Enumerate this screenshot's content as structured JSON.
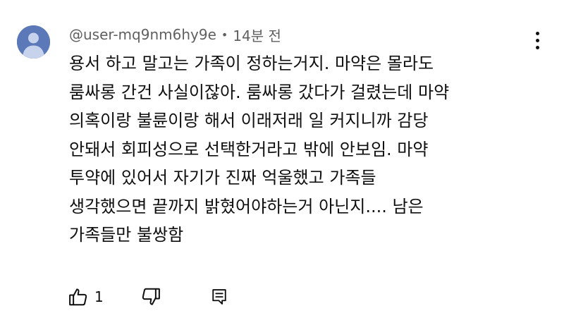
{
  "comment": {
    "author": "@user-mq9nm6hy9e",
    "separator": "•",
    "timestamp": "14분 전",
    "lines": [
      "용서 하고 말고는 가족이 정하는거지. 마약은 몰라도",
      "룸싸롱 간건 사실이잖아. 룸싸롱 갔다가 걸렸는데 마약",
      "의혹이랑 불륜이랑 해서 이래저래 일 커지니까 감당",
      "안돼서 회피성으로 선택한거라고 밖에 안보임. 마약",
      "투약에 있어서 자기가 진짜 억울했고 가족들",
      "생각했으면 끝까지 밝혔어야하는거 아닌지.... 남은",
      "가족들만 불쌍함"
    ],
    "like_count": "1"
  },
  "icons": {
    "avatar": "default-avatar-icon",
    "menu": "more-vertical-icon",
    "like": "thumbs-up-icon",
    "dislike": "thumbs-down-icon",
    "reply": "reply-comment-icon"
  },
  "colors": {
    "avatar_bg": "#5b78b8",
    "avatar_fg": "#c7d3ec",
    "text_primary": "#0f0f0f",
    "text_secondary": "#606060"
  }
}
